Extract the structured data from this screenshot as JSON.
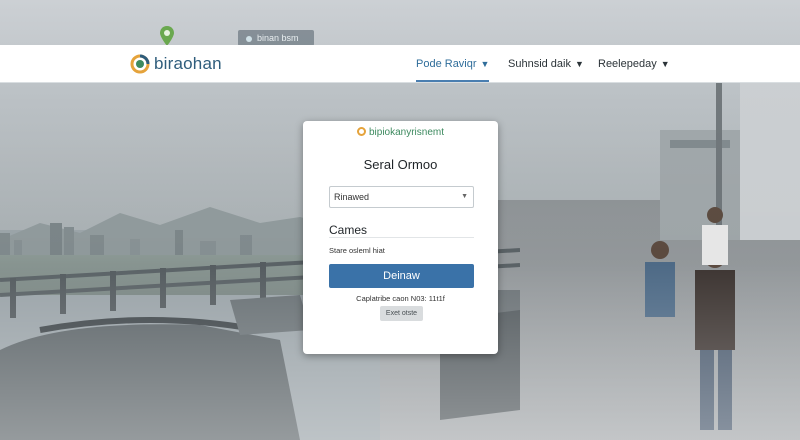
{
  "browser": {
    "url_text": "binan bsm"
  },
  "header": {
    "brand_name": "biraohan",
    "nav": [
      {
        "label": "Pode Raviqr",
        "active": true
      },
      {
        "label": "Suhnsid daik",
        "active": false
      },
      {
        "label": "Reelepeday",
        "active": false
      }
    ]
  },
  "card": {
    "brand": "bipiokanyrisnemt",
    "title": "Seral Ormoo",
    "select_value": "Rinawed",
    "section_title": "Cames",
    "hint": "Stare osleml hiat",
    "primary_label": "Deinaw",
    "meta": "Caplatribe caon N03: 11t1f",
    "secondary_label": "Exet otste"
  },
  "icons": {
    "brand_logo": "brand-logo-icon",
    "location": "location-pin-icon",
    "dropdown": "chevron-down-icon"
  },
  "colors": {
    "accent": "#3a72a8",
    "brand_text": "#2f5d7c",
    "card_brand_text": "#3d8a5f",
    "header_bg": "#ffffff"
  }
}
